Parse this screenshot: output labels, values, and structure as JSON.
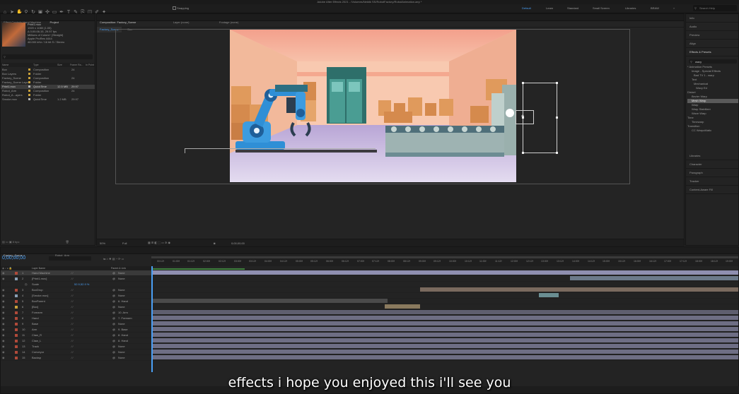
{
  "window": {
    "title": "Adobe After Effects 2021 - /Volumes/Nektik SS/RobotFactory/RobotAnimation.aep *"
  },
  "toolbar": {
    "snapping_label": "Snapping",
    "workspaces": [
      "Default",
      "Learn",
      "Standard",
      "Small Screen",
      "Libraries",
      "BRAW"
    ],
    "search_placeholder": "Search Help"
  },
  "project_panel": {
    "tab_effects": "Effect Controls Hand Machine",
    "tab_project": "Project",
    "selected_name": "Print1.mov",
    "info_lines": [
      "1920 x 1080 (1.00)",
      "Δ 0;00;06;15, 29.97 fps",
      "Millions of Colors+ (Straight)",
      "Apple ProRes 4444",
      "48.000 kHz / 16 bit S / Stereo"
    ],
    "columns": [
      "Name",
      "Type",
      "Size",
      "Frame Ra...",
      "In Point"
    ],
    "items": [
      {
        "name": "Box",
        "type": "Composition",
        "size": "",
        "fps": "24",
        "color": "#c9a13a"
      },
      {
        "name": "Box Layers",
        "type": "Folder",
        "size": "",
        "fps": "",
        "color": "#c9a13a"
      },
      {
        "name": "Factory_Scene",
        "type": "Composition",
        "size": "",
        "fps": "24",
        "color": "#c9a13a"
      },
      {
        "name": "Factory_Scene Layers",
        "type": "Folder",
        "size": "",
        "fps": "",
        "color": "#c9a13a"
      },
      {
        "name": "Print1.mov",
        "type": "QuickTime",
        "size": "12.5 MB",
        "fps": "29.97",
        "color": "#b7b7b7"
      },
      {
        "name": "Robot_Arm",
        "type": "Composition",
        "size": "",
        "fps": "24",
        "color": "#c9a13a"
      },
      {
        "name": "Robot_A...ayers",
        "type": "Folder",
        "size": "",
        "fps": "",
        "color": "#c9a13a"
      },
      {
        "name": "Smoke.mov",
        "type": "QuickTime",
        "size": "1.2 MB",
        "fps": "29.97",
        "color": "#b7b7b7"
      }
    ],
    "bpc": "8 bpc"
  },
  "composition": {
    "tabs": [
      "Composition: Factory_Scene",
      "Layer (none)",
      "Footage (none)"
    ],
    "breadcrumbs": [
      "Factory_Scene",
      "Box"
    ],
    "zoom": "50%",
    "resolution": "Full",
    "timecode": "0;00;00;00",
    "scene_colors": {
      "wall": "#f6b7a0",
      "ceiling": "#f39c86",
      "floor": "#c9b8de",
      "robot": "#2f8fd6",
      "conveyor": "#6d7f86",
      "door": "#3d8e86"
    }
  },
  "timeline": {
    "tabs": [
      "Factory_Scene",
      "Robot_Arm"
    ],
    "timecode": "0;00;00;00",
    "header_cols": [
      "Layer Name",
      "Parent & Link"
    ],
    "ruler": [
      "00:12f",
      "01:00f",
      "01:12f",
      "02:00f",
      "02:12f",
      "03:00f",
      "03:12f",
      "04:00f",
      "04:12f",
      "05:00f",
      "05:12f",
      "06:00f",
      "06:12f",
      "07:00f",
      "07:12f",
      "08:00f",
      "08:12f",
      "09:00f",
      "09:12f",
      "10:00f",
      "10:12f",
      "11:00f",
      "11:12f",
      "12:00f",
      "12:12f",
      "13:00f",
      "13:12f",
      "14:00f",
      "14:12f",
      "15:00f",
      "15:12f",
      "16:00f",
      "16:12f",
      "17:00f",
      "17:12f",
      "18:00f",
      "18:12f",
      "19:00f"
    ],
    "scale_label": "Scale",
    "scale_value": "52.9,52.9 %",
    "layers": [
      {
        "num": "1",
        "name": "Hand Machine",
        "parent": "None",
        "color": "#b04a3a",
        "sel": true
      },
      {
        "num": "2",
        "name": "[Print1.mov]",
        "parent": "None",
        "color": "#8aa0b5",
        "sel": false
      },
      {
        "num": "3",
        "name": "BoxDrop",
        "parent": "None",
        "color": "#b04a3a",
        "sel": false
      },
      {
        "num": "4",
        "name": "[Smoke.mov]",
        "parent": "None",
        "color": "#8aa0b5",
        "sel": false
      },
      {
        "num": "5",
        "name": "BoxParent",
        "parent": "6. Hand",
        "color": "#b04a3a",
        "sel": false
      },
      {
        "num": "6",
        "name": "[Box]",
        "parent": "None",
        "color": "#c9a13a",
        "sel": false
      },
      {
        "num": "7",
        "name": "Forearm",
        "parent": "10. Arm",
        "color": "#b04a3a",
        "sel": false
      },
      {
        "num": "8",
        "name": "Hand",
        "parent": "7. Forearm",
        "color": "#b04a3a",
        "sel": false
      },
      {
        "num": "9",
        "name": "Base",
        "parent": "None",
        "color": "#b04a3a",
        "sel": false
      },
      {
        "num": "10",
        "name": "Arm",
        "parent": "9. Base",
        "color": "#b04a3a",
        "sel": false
      },
      {
        "num": "11",
        "name": "Claw_R",
        "parent": "8. Hand",
        "color": "#b04a3a",
        "sel": false
      },
      {
        "num": "12",
        "name": "Claw_L",
        "parent": "8. Hand",
        "color": "#b04a3a",
        "sel": false
      },
      {
        "num": "13",
        "name": "Track",
        "parent": "None",
        "color": "#b04a3a",
        "sel": false
      },
      {
        "num": "14",
        "name": "Conveyor",
        "parent": "None",
        "color": "#b04a3a",
        "sel": false
      },
      {
        "num": "15",
        "name": "Backsp",
        "parent": "None",
        "color": "#b04a3a",
        "sel": false
      }
    ]
  },
  "right_panel": {
    "sections_top": [
      "Info",
      "Audio",
      "Preview",
      "Align",
      "Effects & Presets"
    ],
    "search_value": "wavy",
    "tree": [
      {
        "text": "* Animation Presets",
        "indent": 0
      },
      {
        "text": "Image - Special Effects",
        "indent": 2
      },
      {
        "text": "Bad TV 1 - warp",
        "indent": 3
      },
      {
        "text": "Text",
        "indent": 2
      },
      {
        "text": "Mechanical",
        "indent": 3
      },
      {
        "text": "Wavy Ed",
        "indent": 4
      },
      {
        "text": "Distort",
        "indent": 0
      },
      {
        "text": "Bezier Warp",
        "indent": 2
      },
      {
        "text": "Mesh Warp",
        "indent": 2,
        "sel": true
      },
      {
        "text": "Warp",
        "indent": 2
      },
      {
        "text": "Warp Stabilizer",
        "indent": 2
      },
      {
        "text": "Wave Warp",
        "indent": 2
      },
      {
        "text": "Time",
        "indent": 0
      },
      {
        "text": "Timewarp",
        "indent": 2
      },
      {
        "text": "Transition",
        "indent": 0
      },
      {
        "text": "CC WarpoMatic",
        "indent": 2
      }
    ],
    "sections_bottom": [
      "Libraries",
      "Character",
      "Paragraph",
      "Tracker",
      "Content-Aware Fill"
    ]
  },
  "subtitle": "effects i hope you enjoyed this i'll see you"
}
